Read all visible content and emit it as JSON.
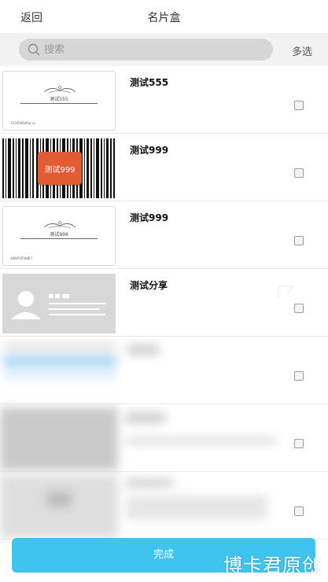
{
  "header": {
    "back_label": "返回",
    "title": "名片盒"
  },
  "search": {
    "placeholder": "搜索",
    "multi_select_label": "多选"
  },
  "cards": [
    {
      "name": "测试555",
      "logo_text": "测试555",
      "small_text": "1234566dfsa.cc",
      "style": "white"
    },
    {
      "name": "测试999",
      "badge_text": "测试999",
      "style": "barcode"
    },
    {
      "name": "测试999",
      "logo_text": "测试999",
      "small_text": "18605056867",
      "style": "white"
    },
    {
      "name": "测试分享",
      "style": "share"
    }
  ],
  "footer": {
    "done_label": "完成"
  },
  "watermark": "博卡君原创",
  "colors": {
    "accent": "#3fc3ef",
    "badge": "#e15c32"
  }
}
